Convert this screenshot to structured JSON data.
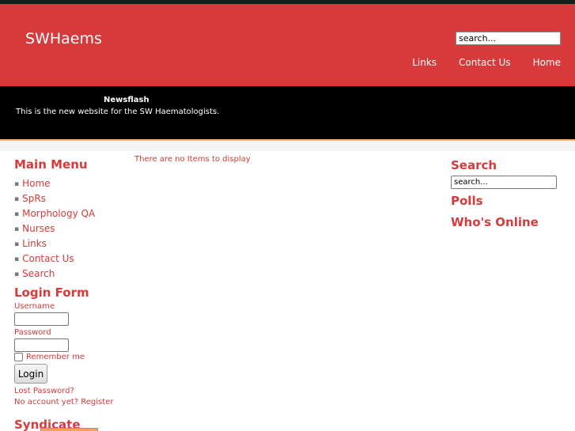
{
  "header": {
    "site_title": "SWHaems",
    "search_value": "search...",
    "nav": [
      "Links",
      "Contact Us",
      "Home"
    ]
  },
  "newsflash": {
    "title": "Newsflash",
    "text": "This is the new website for the SW Haematologists."
  },
  "main_menu": {
    "title": "Main Menu",
    "items": [
      "Home",
      "SpRs",
      "Morphology QA",
      "Nurses",
      "Links",
      "Contact Us",
      "Search"
    ]
  },
  "login_form": {
    "title": "Login Form",
    "username_label": "Username",
    "password_label": "Password",
    "remember_label": "Remember me",
    "login_button": "Login",
    "lost_password": "Lost Password?",
    "register": "No account yet? Register"
  },
  "syndicate": {
    "title": "Syndicate"
  },
  "content": {
    "message": "There are no Items to display"
  },
  "right": {
    "search_title": "Search",
    "search_value": "search...",
    "polls_title": "Polls",
    "whos_online_title": "Who's Online"
  },
  "colors": {
    "brand_red": "#d63a3a",
    "newsbar": "#000000"
  }
}
